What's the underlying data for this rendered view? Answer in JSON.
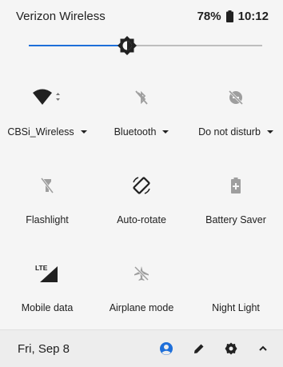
{
  "status_bar": {
    "carrier": "Verizon Wireless",
    "battery_percent": "78%",
    "time": "10:12"
  },
  "brightness": {
    "level_fraction": 0.42,
    "accent_color": "#1e6fd9"
  },
  "tiles": [
    {
      "label": "CBSi_Wireless",
      "icon": "wifi-icon",
      "has_dropdown": true,
      "active": true
    },
    {
      "label": "Bluetooth",
      "icon": "bluetooth-off-icon",
      "has_dropdown": true,
      "active": false
    },
    {
      "label": "Do not disturb",
      "icon": "do-not-disturb-off-icon",
      "has_dropdown": true,
      "active": false
    },
    {
      "label": "Flashlight",
      "icon": "flashlight-off-icon",
      "has_dropdown": false,
      "active": false
    },
    {
      "label": "Auto-rotate",
      "icon": "auto-rotate-icon",
      "has_dropdown": false,
      "active": true
    },
    {
      "label": "Battery Saver",
      "icon": "battery-saver-icon",
      "has_dropdown": false,
      "active": false
    },
    {
      "label": "Mobile data",
      "icon": "mobile-data-lte-icon",
      "has_dropdown": false,
      "active": true
    },
    {
      "label": "Airplane mode",
      "icon": "airplane-mode-icon",
      "has_dropdown": false,
      "active": false
    },
    {
      "label": "Night Light",
      "icon": "night-light-icon",
      "has_dropdown": false,
      "active": false
    }
  ],
  "mobile_data_badge": "LTE",
  "footer": {
    "date": "Fri, Sep 8",
    "user_icon_color": "#1e6fd9"
  }
}
